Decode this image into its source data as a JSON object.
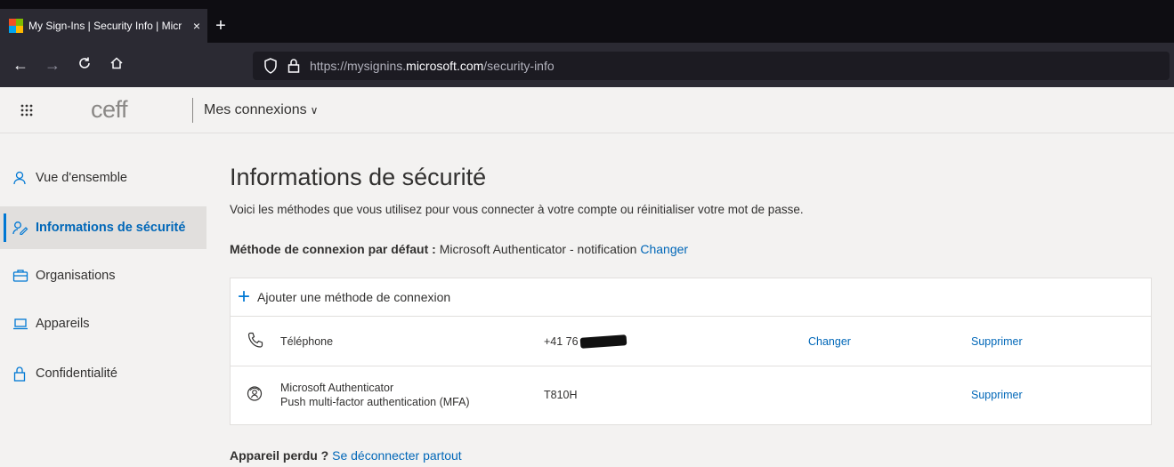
{
  "browser": {
    "tab_title": "My Sign-Ins | Security Info | Micr",
    "tab_close": "×",
    "new_tab": "+",
    "url_prefix": "https://mysignins.",
    "url_host": "microsoft.com",
    "url_path": "/security-info"
  },
  "header": {
    "logo_text": "ceff",
    "app_title": "Mes connexions",
    "app_chevron": "∨"
  },
  "sidebar": {
    "items": [
      {
        "label": "Vue d'ensemble",
        "icon": "person-icon"
      },
      {
        "label": "Informations de sécurité",
        "icon": "security-info-icon",
        "active": true
      },
      {
        "label": "Organisations",
        "icon": "briefcase-icon"
      },
      {
        "label": "Appareils",
        "icon": "laptop-icon"
      },
      {
        "label": "Confidentialité",
        "icon": "lock-icon"
      }
    ]
  },
  "main": {
    "title": "Informations de sécurité",
    "subtitle": "Voici les méthodes que vous utilisez pour vous connecter à votre compte ou réinitialiser votre mot de passe.",
    "default_method_label": "Méthode de connexion par défaut :",
    "default_method_value": "Microsoft Authenticator - notification",
    "default_method_change": "Changer",
    "add_method_label": "Ajouter une méthode de connexion",
    "methods": [
      {
        "name": "Téléphone",
        "name2": "",
        "value": "+41 76",
        "change": "Changer",
        "delete": "Supprimer"
      },
      {
        "name": "Microsoft Authenticator",
        "name2": "Push multi-factor authentication (MFA)",
        "value": "T810H",
        "change": "",
        "delete": "Supprimer"
      }
    ],
    "lost_device_label": "Appareil perdu ?",
    "lost_device_link": "Se déconnecter partout"
  },
  "colors": {
    "accent": "#0078d4",
    "link": "#0067b8",
    "background": "#f3f2f1"
  }
}
